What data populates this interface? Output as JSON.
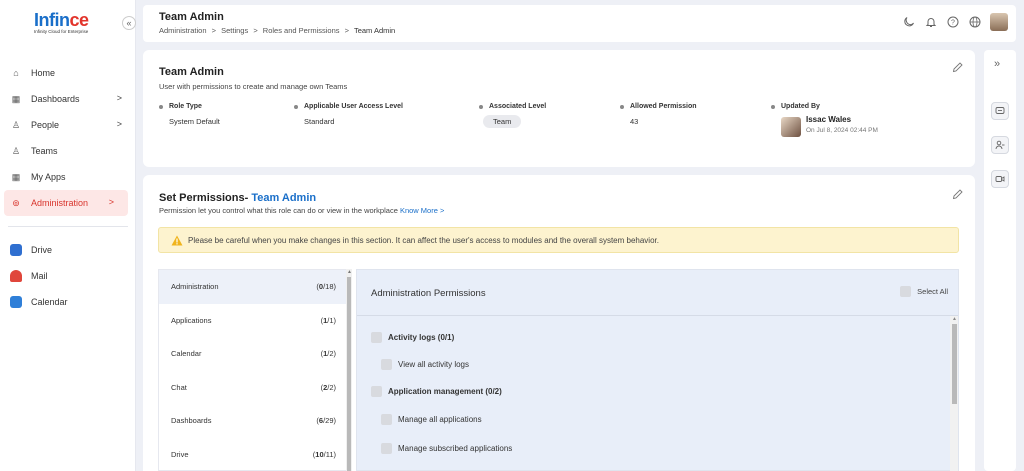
{
  "brand": {
    "logo_main": "Infin",
    "logo_accent": "ce",
    "tagline": "Infinity Cloud for Enterprise",
    "colors": {
      "blue": "#1a6fc9",
      "red": "#e2342b",
      "active_bg": "#fde7e6"
    }
  },
  "sidebar": {
    "collapse_icon": "«",
    "items": [
      {
        "label": "Home",
        "icon": "home-icon",
        "glyph": "⌂",
        "has_chevron": false
      },
      {
        "label": "Dashboards",
        "icon": "dashboard-icon",
        "glyph": "▦",
        "has_chevron": true
      },
      {
        "label": "People",
        "icon": "person-icon",
        "glyph": "♙",
        "has_chevron": true
      },
      {
        "label": "Teams",
        "icon": "team-icon",
        "glyph": "♙",
        "has_chevron": false
      },
      {
        "label": "My Apps",
        "icon": "apps-icon",
        "glyph": "▦",
        "has_chevron": false
      },
      {
        "label": "Administration",
        "icon": "admin-icon",
        "glyph": "⊚",
        "has_chevron": true,
        "active": true
      }
    ],
    "apps": [
      {
        "label": "Drive",
        "icon": "drive-icon",
        "color": "#2f6fd0"
      },
      {
        "label": "Mail",
        "icon": "mail-icon",
        "color": "#e0463b"
      },
      {
        "label": "Calendar",
        "icon": "calendar-icon",
        "color": "#2f7fd8"
      }
    ]
  },
  "header": {
    "title": "Team Admin",
    "breadcrumb": [
      "Administration",
      ">",
      "Settings",
      ">",
      "Roles and Permissions",
      ">",
      "Team Admin"
    ]
  },
  "role": {
    "title": "Team Admin",
    "description": "User with permissions to create and manage own Teams",
    "role_type_label": "Role Type",
    "role_type": "System Default",
    "access_level_label": "Applicable User Access Level",
    "access_level": "Standard",
    "associated_label": "Associated Level",
    "associated": "Team",
    "allowed_label": "Allowed Permission",
    "allowed": "43",
    "updated_label": "Updated By",
    "updated_name": "Issac Wales",
    "updated_date": "On Jul 8, 2024 02:44 PM"
  },
  "permissions": {
    "title_prefix": "Set Permissions- ",
    "title_role": "Team Admin",
    "subtitle": "Permission let you control what this role can do or view in the workplace ",
    "know_more": "Know More >",
    "warning": "Please be careful when you make changes in this section. It can affect the user's access to modules and the overall system behavior.",
    "categories": [
      {
        "name": "Administration",
        "count_open": "(",
        "count_num": "0",
        "count_rest": "/18)",
        "active": true
      },
      {
        "name": "Applications",
        "count_open": "(",
        "count_num": "1",
        "count_rest": "/1)"
      },
      {
        "name": "Calendar",
        "count_open": "(",
        "count_num": "1",
        "count_rest": "/2)"
      },
      {
        "name": "Chat",
        "count_open": "(",
        "count_num": "2",
        "count_rest": "/2)"
      },
      {
        "name": "Dashboards",
        "count_open": "(",
        "count_num": "6",
        "count_rest": "/29)"
      },
      {
        "name": "Drive",
        "count_open": "(",
        "count_num": "10",
        "count_rest": "/11)"
      }
    ],
    "panel_title": "Administration Permissions",
    "select_all": "Select All",
    "rows": [
      {
        "label": "Activity logs (0/1)",
        "group": true
      },
      {
        "label": "View all activity logs",
        "group": false
      },
      {
        "label": "Application management (0/2)",
        "group": true
      },
      {
        "label": "Manage all applications",
        "group": false
      },
      {
        "label": "Manage subscribed applications",
        "group": false
      }
    ]
  }
}
